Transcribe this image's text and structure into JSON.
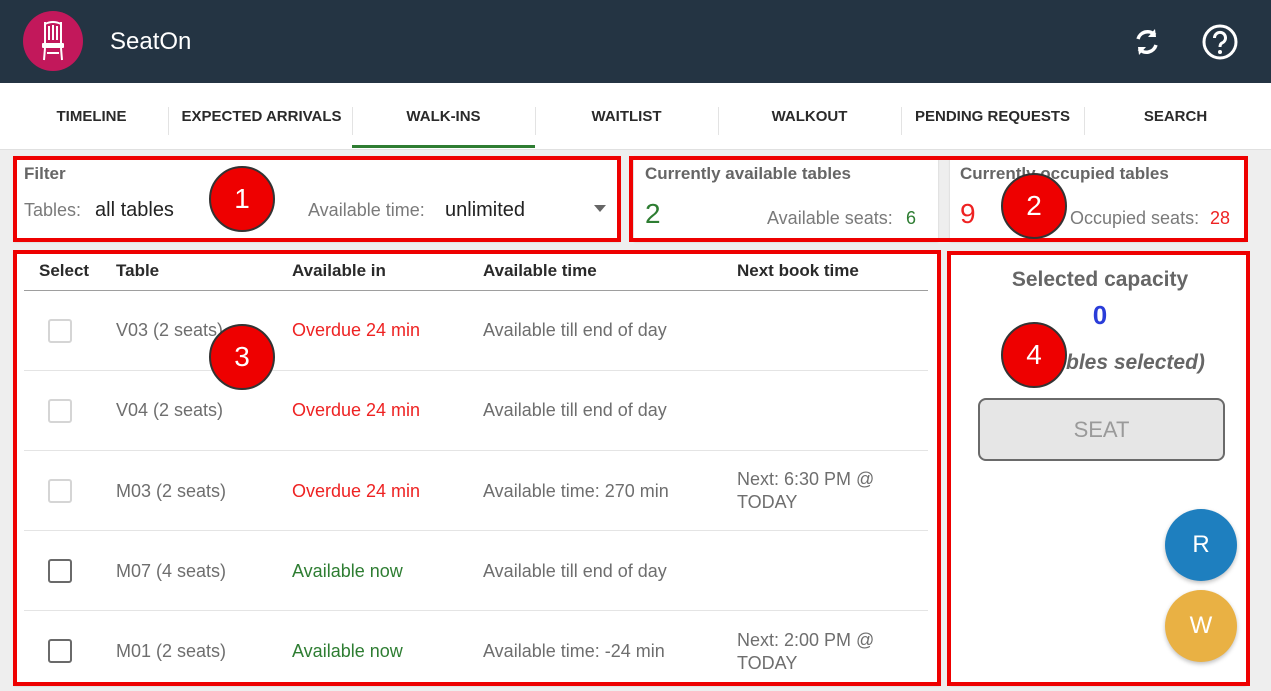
{
  "app": {
    "title": "SeatOn"
  },
  "tabs": [
    {
      "label": "TIMELINE"
    },
    {
      "label": "EXPECTED ARRIVALS"
    },
    {
      "label": "WALK-INS"
    },
    {
      "label": "WAITLIST"
    },
    {
      "label": "WALKOUT"
    },
    {
      "label": "PENDING REQUESTS"
    },
    {
      "label": "SEARCH"
    }
  ],
  "active_tab": "WALK-INS",
  "filter": {
    "heading": "Filter",
    "tables_label": "Tables:",
    "tables_value": "all tables",
    "available_time_label": "Available time:",
    "available_time_value": "unlimited"
  },
  "available_summary": {
    "title": "Currently available tables",
    "count": "2",
    "seats_label": "Available seats:",
    "seats_value": "6"
  },
  "occupied_summary": {
    "title": "Currently occupied tables",
    "count": "9",
    "seats_label": "Occupied seats:",
    "seats_value": "28"
  },
  "table_list": {
    "headers": {
      "select": "Select",
      "table": "Table",
      "available_in": "Available in",
      "available_time": "Available time",
      "next_book_time": "Next book time"
    },
    "rows": [
      {
        "table": "V03 (2 seats)",
        "available_in": "Overdue 24 min",
        "available_time": "Available till end of day",
        "next_line1": "",
        "next_line2": ""
      },
      {
        "table": "V04 (2 seats)",
        "available_in": "Overdue 24 min",
        "available_time": "Available till end of day",
        "next_line1": "",
        "next_line2": ""
      },
      {
        "table": "M03 (2 seats)",
        "available_in": "Overdue 24 min",
        "available_time": "Available time: 270 min",
        "next_line1": "Next: 6:30 PM @",
        "next_line2": "TODAY"
      },
      {
        "table": "M07 (4 seats)",
        "available_in": "Available now",
        "available_time": "Available till end of day",
        "next_line1": "",
        "next_line2": ""
      },
      {
        "table": "M01 (2 seats)",
        "available_in": "Available now",
        "available_time": "Available time: -24 min",
        "next_line1": "Next: 2:00 PM @",
        "next_line2": "TODAY"
      }
    ]
  },
  "selection": {
    "title": "Selected capacity",
    "capacity": "0",
    "tables_selected": "bles selected)",
    "seat_button": "SEAT"
  },
  "fabs": {
    "r_label": "R",
    "w_label": "W"
  },
  "badges": {
    "b1": "1",
    "b2": "2",
    "b3": "3",
    "b4": "4"
  },
  "colors": {
    "appbar": "#243443",
    "brand": "#c2185b",
    "green": "#2e7d32",
    "overdue_red": "#ee2222",
    "capacity_blue": "#2a3dd9",
    "fab_r": "#1e7fbf",
    "fab_w": "#e9b144",
    "annotation_red": "#ee0000"
  }
}
